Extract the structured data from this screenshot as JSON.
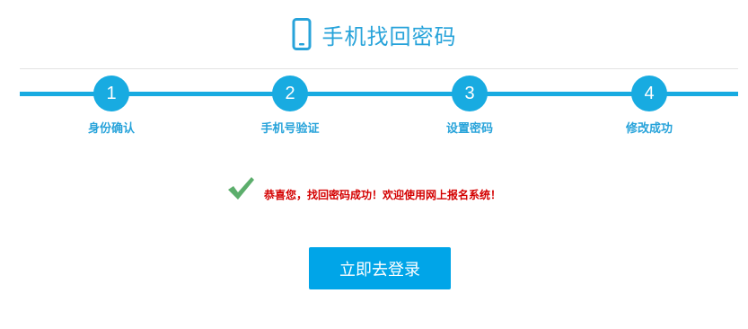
{
  "header": {
    "icon": "mobile-phone-icon",
    "title": "手机找回密码"
  },
  "steps": [
    {
      "number": "1",
      "label": "身份确认"
    },
    {
      "number": "2",
      "label": "手机号验证"
    },
    {
      "number": "3",
      "label": "设置密码"
    },
    {
      "number": "4",
      "label": "修改成功"
    }
  ],
  "message": {
    "icon": "checkmark-icon",
    "text": "恭喜您，找回密码成功！欢迎使用网上报名系统！"
  },
  "actions": {
    "login_label": "立即去登录"
  },
  "colors": {
    "accent": "#18abe1",
    "button": "#00a5e8",
    "success_text": "#d40000",
    "check": "#5cae6c"
  }
}
